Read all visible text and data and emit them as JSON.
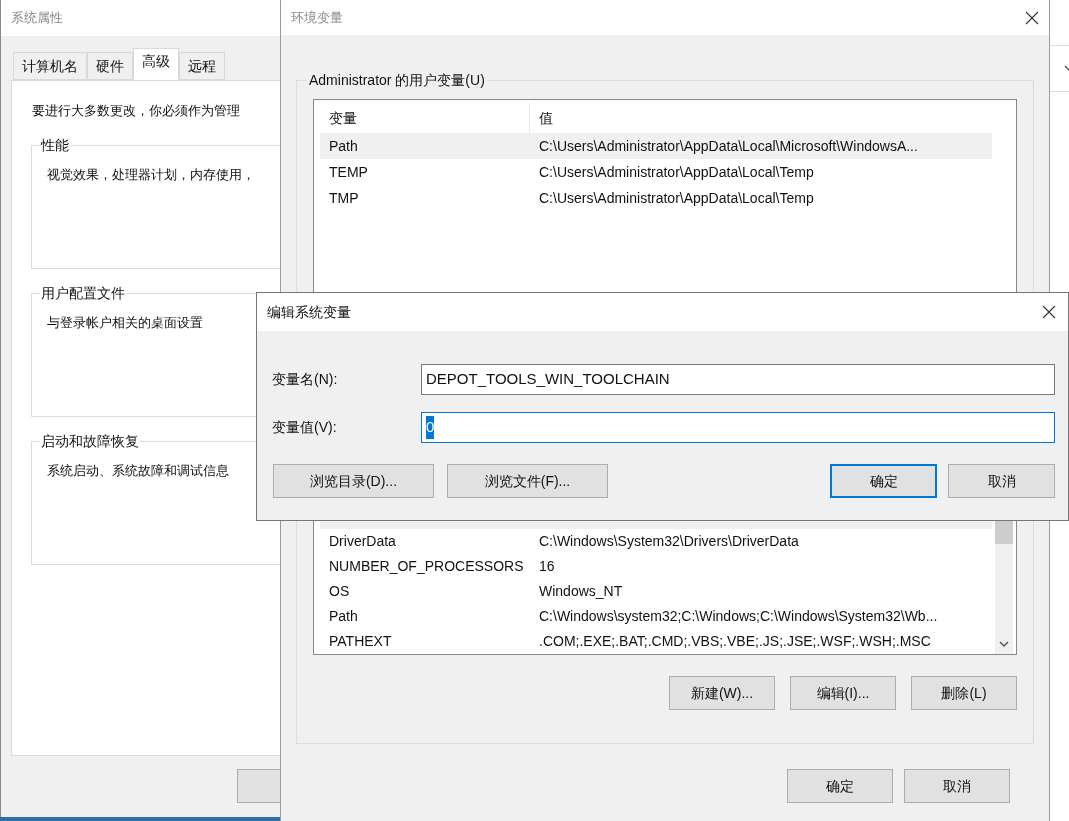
{
  "system_properties": {
    "title": "系统属性",
    "tabs": [
      {
        "label": "计算机名",
        "selected": false
      },
      {
        "label": "硬件",
        "selected": false
      },
      {
        "label": "高级",
        "selected": true
      },
      {
        "label": "远程",
        "selected": false
      }
    ],
    "intro": "要进行大多数更改，你必须作为管理",
    "groups": [
      {
        "title": "性能",
        "text": "视觉效果，处理器计划，内存使用，"
      },
      {
        "title": "用户配置文件",
        "text": "与登录帐户相关的桌面设置"
      },
      {
        "title": "启动和故障恢复",
        "text": "系统启动、系统故障和调试信息"
      }
    ]
  },
  "environment_variables": {
    "title": "环境变量",
    "user_group_title": "Administrator 的用户变量(U)",
    "columns": [
      "变量",
      "值"
    ],
    "user_rows": [
      {
        "name": "Path",
        "value": "C:\\Users\\Administrator\\AppData\\Local\\Microsoft\\WindowsA...",
        "selected": true
      },
      {
        "name": "TEMP",
        "value": "C:\\Users\\Administrator\\AppData\\Local\\Temp",
        "selected": false
      },
      {
        "name": "TMP",
        "value": "C:\\Users\\Administrator\\AppData\\Local\\Temp",
        "selected": false
      }
    ],
    "system_rows": [
      {
        "name": "DriverData",
        "value": "C:\\Windows\\System32\\Drivers\\DriverData"
      },
      {
        "name": "NUMBER_OF_PROCESSORS",
        "value": "16"
      },
      {
        "name": "OS",
        "value": "Windows_NT"
      },
      {
        "name": "Path",
        "value": "C:\\Windows\\system32;C:\\Windows;C:\\Windows\\System32\\Wb..."
      },
      {
        "name": "PATHEXT",
        "value": ".COM;.EXE;.BAT;.CMD;.VBS;.VBE;.JS;.JSE;.WSF;.WSH;.MSC"
      }
    ],
    "system_buttons": [
      "新建(W)...",
      "编辑(I)...",
      "删除(L)"
    ],
    "buttons": [
      "确定",
      "取消"
    ]
  },
  "edit_dialog": {
    "title": "编辑系统变量",
    "fields": [
      {
        "label": "变量名(N):",
        "value": "DEPOT_TOOLS_WIN_TOOLCHAIN",
        "focused": false
      },
      {
        "label": "变量值(V):",
        "value": "0",
        "focused": true
      }
    ],
    "buttons": [
      {
        "label": "浏览目录(D)...",
        "default": false
      },
      {
        "label": "浏览文件(F)...",
        "default": false
      },
      {
        "label": "确定",
        "default": true
      },
      {
        "label": "取消",
        "default": false
      }
    ]
  }
}
